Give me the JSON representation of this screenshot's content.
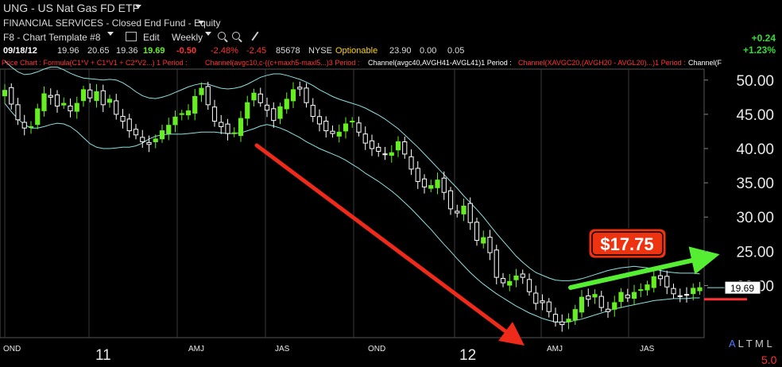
{
  "header": {
    "title": "UNG - US Nat Gas FD ETF",
    "sector": "FINANCIAL SERVICES - Closed End Fund - Equity"
  },
  "toolbar": {
    "template": "F8 - Chart Template #8",
    "edit": "Edit",
    "period": "Weekly"
  },
  "quote": {
    "date": "09/18/12",
    "open": "19.96",
    "high": "20.65",
    "low": "19.36",
    "last": "19.69",
    "change": "-0.50",
    "change_pct": "-2.48%",
    "chg2": "-2.45",
    "volume": "85678",
    "exchange": "NYSE",
    "optionable": "Optionable",
    "f1": "23.90",
    "f2": "0.00",
    "f3": "0.05"
  },
  "change_box": {
    "abs": "+0.24",
    "pct": "+1.23%"
  },
  "studies": {
    "s1": "Price Chart : Formula(C1*V + C1*V1 + C2*V2...) 1 Period :",
    "s2": "Channel(avgc10,c-((c+maxh5-maxl5...)3 Period :",
    "s3": "Channel(avgc40,AVGH41-AVGL41)1 Period :",
    "s4": "Channel(XAVGC20,(AVGH20 - AVGL20)...)1 Period :",
    "s5": "Channel(F"
  },
  "annotation": {
    "price_label": "$17.75"
  },
  "footer": {
    "timeframe": "A L T M L",
    "version": "5.0"
  },
  "colors": {
    "up_candle": "#66ee22",
    "down_candle": "#ffffff",
    "channel": "#8ee0e0",
    "arrow_down": "#ee2a1a",
    "arrow_up": "#55ee33",
    "label_box": "#ee3311",
    "negative": "#ff3333",
    "positive": "#33dd33"
  },
  "chart_data": {
    "type": "candlestick",
    "ylim": [
      12.4,
      51.6
    ],
    "y_ticks": [
      "50.00",
      "45.00",
      "40.00",
      "35.00",
      "30.00",
      "25.00",
      "20.00"
    ],
    "y_tick_values": [
      50,
      45,
      40,
      35,
      30,
      25,
      20
    ],
    "x_labels": [
      "OND",
      "11",
      "AMJ",
      "JAS",
      "OND",
      "12",
      "AMJ",
      "JAS"
    ],
    "last_price": 19.69,
    "red_line_level": 18.0,
    "series": [
      {
        "name": "weekly_close",
        "values": [
          48.5,
          46.5,
          44.2,
          43.0,
          43.2,
          45.8,
          48.0,
          47.5,
          46.2,
          46.6,
          45.5,
          46.6,
          48.6,
          47.4,
          48.3,
          46.4,
          47.2,
          45.0,
          44.0,
          42.6,
          42.0,
          41.0,
          40.6,
          41.4,
          42.6,
          43.4,
          44.6,
          45.1,
          45.5,
          47.6,
          48.8,
          46.4,
          44.0,
          43.2,
          42.2,
          42.3,
          44.4,
          46.7,
          48.1,
          46.7,
          45.6,
          44.1,
          46.1,
          47.2,
          48.6,
          48.7,
          46.7,
          44.7,
          43.6,
          42.6,
          42.2,
          42.4,
          43.6,
          44.0,
          42.4,
          40.8,
          40.0,
          39.6,
          39.1,
          39.4,
          41.0,
          39.2,
          37.0,
          35.2,
          34.4,
          34.6,
          35.4,
          33.6,
          31.2,
          30.6,
          31.6,
          29.2,
          26.6,
          27.0,
          24.8,
          21.2,
          20.4,
          20.6,
          21.4,
          21.2,
          19.1,
          17.4,
          17.5,
          16.2,
          14.7,
          14.3,
          15.1,
          16.5,
          18.3,
          18.0,
          18.7,
          16.8,
          16.2,
          17.5,
          19.0,
          18.2,
          19.0,
          19.4,
          20.1,
          21.3,
          21.0,
          19.8,
          18.8,
          18.4,
          18.6,
          19.6,
          19.69
        ]
      },
      {
        "name": "channel_upper",
        "values": [
          52.8,
          51.9,
          51.2,
          50.8,
          50.9,
          51.2,
          51.6,
          51.9,
          51.9,
          51.5,
          51.0,
          50.6,
          50.3,
          50.2,
          50.1,
          50.0,
          50.1,
          50.0,
          49.6,
          49.0,
          48.3,
          47.7,
          47.4,
          47.3,
          47.5,
          47.8,
          48.2,
          48.6,
          49.0,
          49.3,
          49.5,
          49.4,
          49.1,
          48.8,
          48.7,
          48.8,
          49.0,
          49.4,
          49.9,
          50.4,
          50.7,
          50.9,
          50.9,
          50.7,
          50.4,
          50.1,
          49.7,
          49.2,
          48.6,
          48.1,
          47.6,
          47.2,
          46.9,
          46.6,
          46.3,
          45.9,
          45.4,
          44.9,
          44.3,
          43.6,
          42.9,
          42.0,
          41.1,
          40.2,
          39.2,
          38.2,
          37.2,
          36.2,
          35.2,
          34.2,
          33.1,
          32.1,
          31.1,
          30.0,
          28.8,
          27.6,
          26.5,
          25.4,
          24.3,
          23.4,
          22.6,
          21.9,
          21.5,
          21.1,
          20.8,
          20.7,
          20.7,
          20.8,
          21.0,
          21.3,
          21.6,
          21.9,
          22.2,
          22.4,
          22.6,
          22.7,
          22.8,
          22.7,
          22.6,
          22.4,
          22.2,
          22.0,
          21.9,
          21.8,
          21.8,
          21.8,
          21.7
        ]
      },
      {
        "name": "channel_lower",
        "values": [
          46.6,
          45.4,
          44.3,
          43.5,
          43.0,
          43.0,
          43.2,
          43.5,
          43.7,
          43.6,
          43.2,
          42.5,
          41.6,
          40.7,
          40.2,
          40.0,
          40.0,
          40.1,
          40.2,
          40.2,
          40.4,
          40.8,
          41.4,
          41.8,
          42.0,
          42.1,
          42.1,
          42.1,
          42.2,
          42.3,
          42.4,
          42.4,
          42.4,
          42.3,
          42.2,
          42.2,
          42.3,
          42.6,
          42.9,
          43.3,
          43.5,
          43.3,
          43.0,
          42.6,
          42.1,
          41.6,
          41.0,
          40.5,
          40.0,
          39.6,
          39.2,
          38.8,
          38.3,
          37.7,
          37.1,
          36.4,
          35.8,
          35.2,
          34.5,
          33.8,
          33.0,
          32.1,
          31.2,
          30.2,
          29.2,
          28.2,
          27.1,
          26.0,
          25.0,
          23.9,
          22.9,
          21.9,
          21.0,
          20.2,
          19.5,
          18.8,
          18.2,
          17.6,
          17.0,
          16.5,
          16.0,
          15.6,
          15.2,
          14.9,
          14.7,
          14.6,
          14.7,
          14.9,
          15.1,
          15.4,
          15.7,
          16.0,
          16.3,
          16.6,
          16.8,
          17.0,
          17.2,
          17.4,
          17.6,
          17.8,
          17.9,
          18.0,
          18.1,
          18.1,
          18.1,
          18.2,
          18.2
        ]
      }
    ]
  }
}
